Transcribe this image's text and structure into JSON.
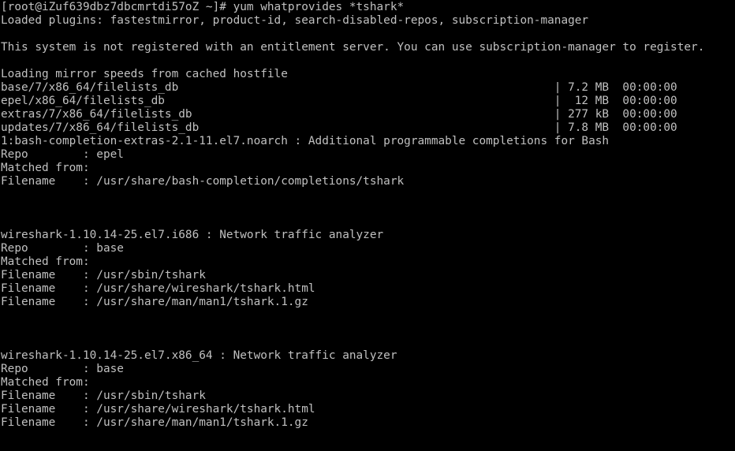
{
  "terminal": {
    "fg_color": "#c0c0c0",
    "bg_color": "#000000",
    "lines": [
      "[root@iZuf639dbz7dbcmrtdi57oZ ~]# yum whatprovides *tshark*",
      "Loaded plugins: fastestmirror, product-id, search-disabled-repos, subscription-manager",
      "",
      "This system is not registered with an entitlement server. You can use subscription-manager to register.",
      "",
      "Loading mirror speeds from cached hostfile",
      "base/7/x86_64/filelists_db                                                       | 7.2 MB  00:00:00",
      "epel/x86_64/filelists_db                                                         |  12 MB  00:00:00",
      "extras/7/x86_64/filelists_db                                                     | 277 kB  00:00:00",
      "updates/7/x86_64/filelists_db                                                    | 7.8 MB  00:00:00",
      "1:bash-completion-extras-2.1-11.el7.noarch : Additional programmable completions for Bash",
      "Repo        : epel",
      "Matched from:",
      "Filename    : /usr/share/bash-completion/completions/tshark",
      "",
      "",
      "",
      "wireshark-1.10.14-25.el7.i686 : Network traffic analyzer",
      "Repo        : base",
      "Matched from:",
      "Filename    : /usr/sbin/tshark",
      "Filename    : /usr/share/wireshark/tshark.html",
      "Filename    : /usr/share/man/man1/tshark.1.gz",
      "",
      "",
      "",
      "wireshark-1.10.14-25.el7.x86_64 : Network traffic analyzer",
      "Repo        : base",
      "Matched from:",
      "Filename    : /usr/sbin/tshark",
      "Filename    : /usr/share/wireshark/tshark.html",
      "Filename    : /usr/share/man/man1/tshark.1.gz"
    ]
  }
}
